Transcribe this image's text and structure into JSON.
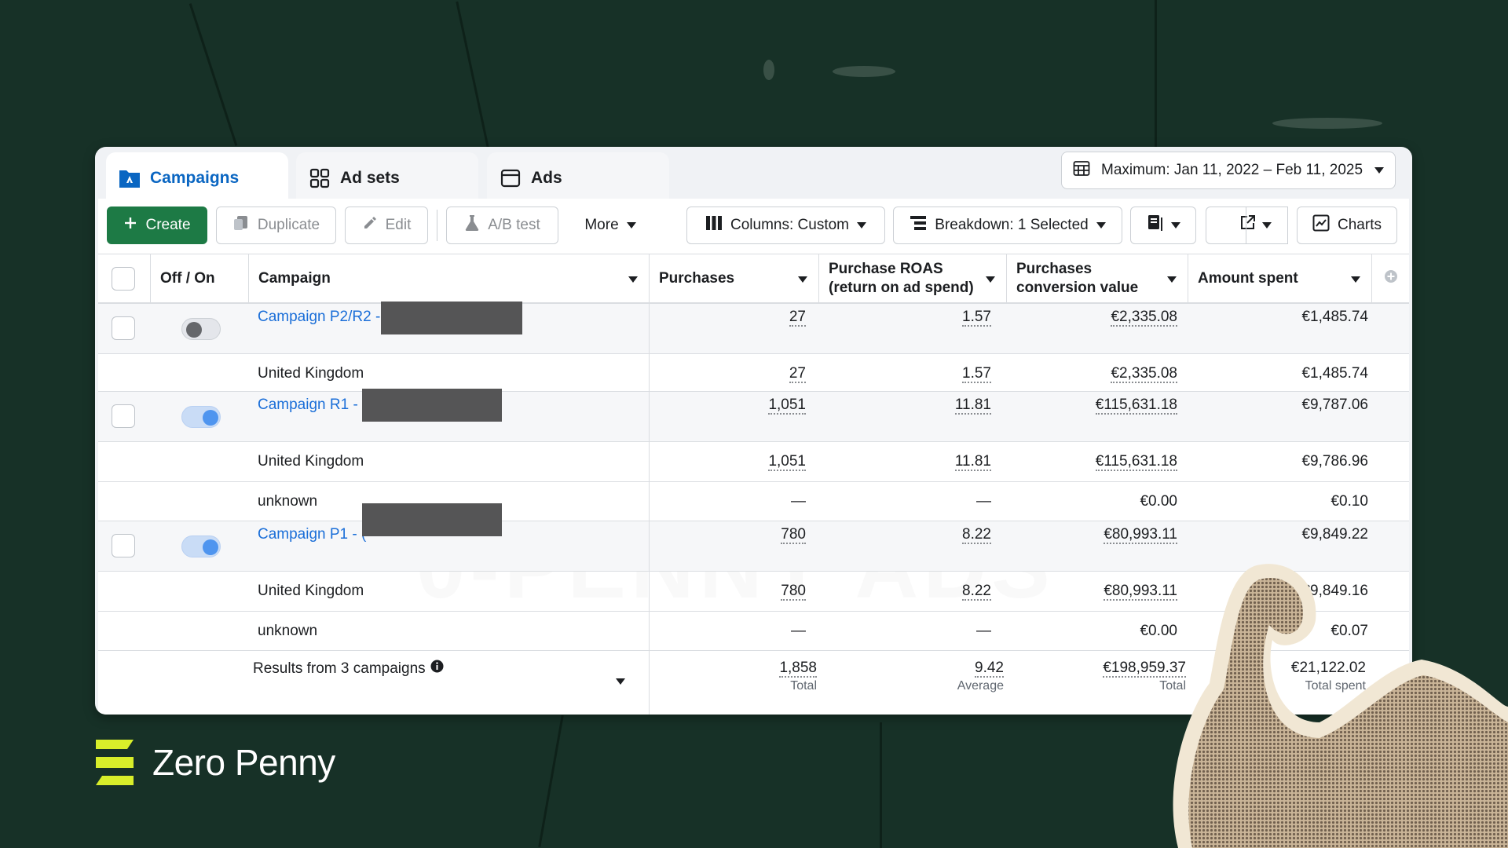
{
  "tabs": [
    {
      "label": "Campaigns",
      "icon": "campaigns-folder-icon",
      "active": true
    },
    {
      "label": "Ad sets",
      "icon": "ad-sets-grid-icon",
      "active": false
    },
    {
      "label": "Ads",
      "icon": "ads-window-icon",
      "active": false
    }
  ],
  "date_range": {
    "label": "Maximum: Jan 11, 2022 – Feb 11, 2025",
    "icon": "calendar-icon"
  },
  "toolbar": {
    "create": "Create",
    "duplicate": "Duplicate",
    "edit": "Edit",
    "ab_test": "A/B test",
    "more": "More",
    "columns": "Columns: Custom",
    "breakdown": "Breakdown: 1 Selected",
    "charts": "Charts"
  },
  "columns": {
    "offon": "Off / On",
    "campaign": "Campaign",
    "purchases": "Purchases",
    "roas_line1": "Purchase ROAS",
    "roas_line2": "(return on ad spend)",
    "conv_line1": "Purchases",
    "conv_line2": "conversion value",
    "spent": "Amount spent"
  },
  "rows": [
    {
      "name": "Campaign P2/R2 -",
      "purchases": "27",
      "roas": "1.57",
      "conv": "€2,335.08",
      "spent": "€1,485.74",
      "toggle": "off"
    },
    {
      "name": "United Kingdom",
      "purchases": "27",
      "roas": "1.57",
      "conv": "€2,335.08",
      "spent": "€1,485.74"
    },
    {
      "name": "Campaign R1 - (",
      "purchases": "1,051",
      "roas": "11.81",
      "conv": "€115,631.18",
      "spent": "€9,787.06",
      "toggle": "on"
    },
    {
      "name": "United Kingdom",
      "purchases": "1,051",
      "roas": "11.81",
      "conv": "€115,631.18",
      "spent": "€9,786.96"
    },
    {
      "name": "unknown",
      "purchases": "—",
      "roas": "—",
      "conv": "€0.00",
      "spent": "€0.10"
    },
    {
      "name": "Campaign P1 - (",
      "purchases": "780",
      "roas": "8.22",
      "conv": "€80,993.11",
      "spent": "€9,849.22",
      "toggle": "on"
    },
    {
      "name": "United Kingdom",
      "purchases": "780",
      "roas": "8.22",
      "conv": "€80,993.11",
      "spent": "€9,849.16"
    },
    {
      "name": "unknown",
      "purchases": "—",
      "roas": "—",
      "conv": "€0.00",
      "spent": "€0.07"
    }
  ],
  "totals": {
    "label": "Results from 3 campaigns",
    "purchases": "1,858",
    "purchases_sub": "Total",
    "roas": "9.42",
    "roas_sub": "Average",
    "conv": "€198,959.37",
    "conv_sub": "Total",
    "spent": "€21,122.02",
    "spent_sub": "Total spent"
  },
  "watermark": "0-PENNY ADS",
  "brand": {
    "name": "Zero Penny",
    "accent": "#d8ee2a"
  },
  "colors": {
    "background": "#173127",
    "create_button": "#1d7a45",
    "link": "#1a6ed8"
  }
}
